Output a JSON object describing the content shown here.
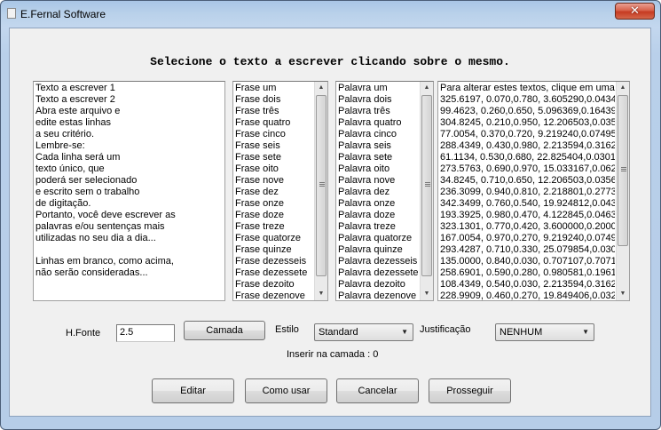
{
  "window": {
    "title": "E.Fernal Software",
    "close_glyph": "✕"
  },
  "heading": "Selecione o texto a escrever clicando sobre o mesmo.",
  "lists": {
    "text": [
      "Texto a escrever 1",
      "Texto a escrever 2",
      "Abra este arquivo e",
      "edite estas linhas",
      "a seu critério.",
      "Lembre-se:",
      "Cada linha será um",
      "texto único, que",
      "poderá ser selecionado",
      "e escrito sem o trabalho",
      "de digitação.",
      "Portanto, você deve escrever as",
      "palavras e/ou sentenças mais",
      "utilizadas no seu dia a dia...",
      "",
      "Linhas em branco, como acima,",
      "não serão consideradas..."
    ],
    "frases": [
      "Frase um",
      "Frase dois",
      "Frase três",
      "Frase quatro",
      "Frase cinco",
      "Frase seis",
      "Frase sete",
      "Frase oito",
      "Frase nove",
      "Frase dez",
      "Frase onze",
      "Frase doze",
      "Frase treze",
      "Frase quatorze",
      "Frase quinze",
      "Frase dezesseis",
      "Frase dezessete",
      "Frase dezoito",
      "Frase dezenove"
    ],
    "palavras": [
      "Palavra um",
      "Palavra dois",
      "Palavra três",
      "Palavra quatro",
      "Palavra cinco",
      "Palavra seis",
      "Palavra sete",
      "Palavra oito",
      "Palavra nove",
      "Palavra dez",
      "Palavra onze",
      "Palavra doze",
      "Palavra treze",
      "Palavra quatorze",
      "Palavra quinze",
      "Palavra dezesseis",
      "Palavra dezessete",
      "Palavra dezoito",
      "Palavra dezenove"
    ],
    "numeros": [
      "Para alterar estes textos, clique em uma lin",
      "325.6197, 0.070,0.780, 3.605290,0.0434",
      "99.4623, 0.260,0.650, 5.096369,0.16439",
      "304.8245, 0.210,0.950, 12.206503,0.035",
      "77.0054, 0.370,0.720, 9.219240,0.07495",
      "288.4349, 0.430,0.980, 2.213594,0.3162",
      "61.1134, 0.530,0.680, 22.825404,0.0301",
      "273.5763, 0.690,0.970, 15.033167,0.062",
      "34.8245, 0.710,0.650, 12.206503,0.0356",
      "236.3099, 0.940,0.810, 2.218801,0.2773",
      "342.3499, 0.760,0.540, 19.924812,0.043",
      "193.3925, 0.980,0.470, 4.122845,0.0463",
      "323.1301, 0.770,0.420, 3.600000,0.2000",
      "167.0054, 0.970,0.270, 9.219240,0.0749",
      "293.4287, 0.710,0.330, 25.079854,0.030",
      "135.0000, 0.840,0.030, 0.707107,0.7071",
      "258.6901, 0.590,0.280, 0.980581,0.1961",
      "108.4349, 0.540,0.030, 2.213594,0.3162",
      "228.9909, 0.460,0.270, 19.849406,0.032"
    ]
  },
  "controls": {
    "hfonte_label": "H.Fonte",
    "hfonte_value": "2.5",
    "camada_button": "Camada",
    "estilo_label": "Estilo",
    "estilo_value": "Standard",
    "justificacao_label": "Justificação",
    "justificacao_value": "NENHUM",
    "inserir_label": "Inserir na camada : 0"
  },
  "buttons": {
    "editar": "Editar",
    "como_usar": "Como usar",
    "cancelar": "Cancelar",
    "prosseguir": "Prosseguir"
  },
  "icons": {
    "window_icon": "document-icon",
    "close_icon": "close-icon",
    "scroll_up": "▲",
    "scroll_down": "▼",
    "combo_arrow": "▼"
  }
}
